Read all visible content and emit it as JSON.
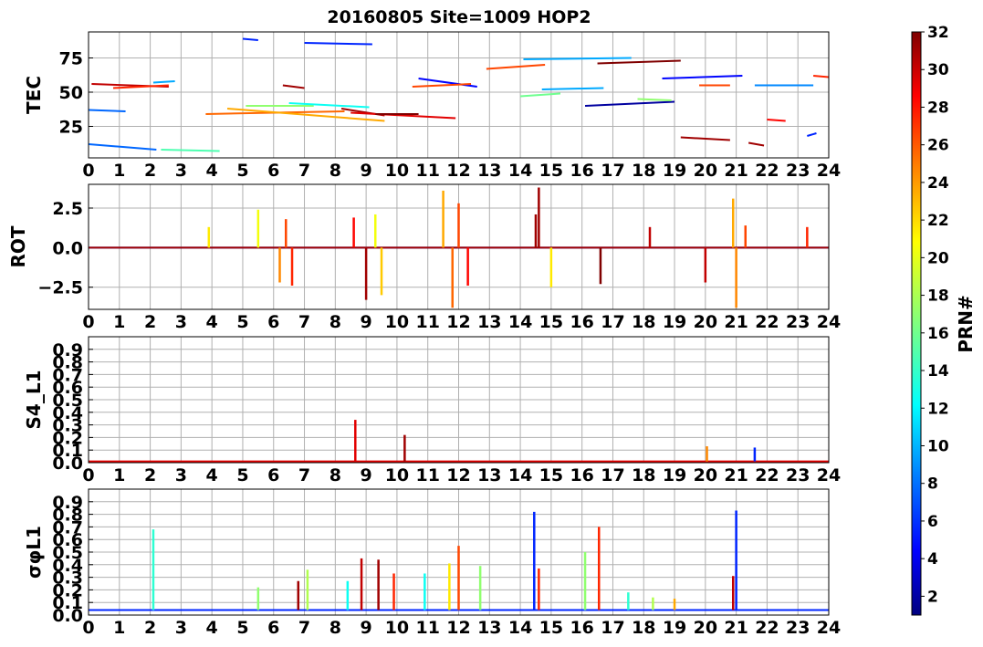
{
  "chart_data": {
    "title": "20160805 Site=1009 HOP2",
    "type": "line",
    "x_ticks": [
      "0",
      "1",
      "2",
      "3",
      "4",
      "5",
      "6",
      "7",
      "8",
      "9",
      "10",
      "11",
      "12",
      "13",
      "14",
      "15",
      "16",
      "17",
      "18",
      "19",
      "20",
      "21",
      "22",
      "23",
      "24"
    ],
    "xlim": [
      0,
      24
    ],
    "grid": true,
    "colorbar": {
      "label": "PRN#",
      "range": [
        1,
        32
      ],
      "ticks": [
        "2",
        "4",
        "6",
        "8",
        "10",
        "12",
        "14",
        "16",
        "18",
        "20",
        "22",
        "24",
        "26",
        "28",
        "30",
        "32"
      ],
      "colormap": [
        "#00007f",
        "#0000ff",
        "#007fff",
        "#00ffff",
        "#7fff7f",
        "#ffff00",
        "#ff7f00",
        "#ff0000",
        "#7f0000"
      ]
    },
    "panels": [
      {
        "ylabel": "TEC",
        "ylim": [
          2,
          94
        ],
        "y_ticks": [
          "25",
          "50",
          "75"
        ],
        "series": [
          {
            "prn": 8,
            "x": [
              0,
              1.2
            ],
            "y": [
              37,
              36
            ]
          },
          {
            "prn": 8,
            "x": [
              0,
              2.2
            ],
            "y": [
              12,
              8
            ]
          },
          {
            "prn": 15,
            "x": [
              2.35,
              4.25
            ],
            "y": [
              8,
              7
            ]
          },
          {
            "prn": 30,
            "x": [
              0.1,
              2.6
            ],
            "y": [
              56,
              54
            ]
          },
          {
            "prn": 27,
            "x": [
              0.8,
              2.6
            ],
            "y": [
              53,
              55
            ]
          },
          {
            "prn": 10,
            "x": [
              2.1,
              2.8
            ],
            "y": [
              57,
              58
            ]
          },
          {
            "prn": 25,
            "x": [
              3.8,
              8.3
            ],
            "y": [
              34,
              36
            ]
          },
          {
            "prn": 23,
            "x": [
              4.5,
              9.6
            ],
            "y": [
              38,
              29
            ]
          },
          {
            "prn": 17,
            "x": [
              5.1,
              7.3
            ],
            "y": [
              40,
              40
            ]
          },
          {
            "prn": 13,
            "x": [
              6.5,
              9.1
            ],
            "y": [
              42,
              39
            ]
          },
          {
            "prn": 31,
            "x": [
              8.2,
              9.6
            ],
            "y": [
              38,
              33
            ]
          },
          {
            "prn": 29,
            "x": [
              8.5,
              11.9
            ],
            "y": [
              35,
              31
            ]
          },
          {
            "prn": 32,
            "x": [
              9.3,
              10.7
            ],
            "y": [
              34,
              34
            ]
          },
          {
            "prn": 31,
            "x": [
              6.3,
              7.0
            ],
            "y": [
              55,
              53
            ]
          },
          {
            "prn": 6,
            "x": [
              5.0,
              5.5
            ],
            "y": [
              89,
              88
            ]
          },
          {
            "prn": 6,
            "x": [
              7.0,
              9.2
            ],
            "y": [
              86,
              85
            ]
          },
          {
            "prn": 5,
            "x": [
              10.7,
              12.6
            ],
            "y": [
              60,
              54
            ]
          },
          {
            "prn": 26,
            "x": [
              10.5,
              12.4
            ],
            "y": [
              54,
              56
            ]
          },
          {
            "prn": 26,
            "x": [
              12.9,
              14.8
            ],
            "y": [
              67,
              70
            ]
          },
          {
            "prn": 10,
            "x": [
              14.1,
              17.6
            ],
            "y": [
              74,
              75
            ]
          },
          {
            "prn": 16,
            "x": [
              14.0,
              15.3
            ],
            "y": [
              47,
              49
            ]
          },
          {
            "prn": 10,
            "x": [
              14.7,
              16.7
            ],
            "y": [
              52,
              53
            ]
          },
          {
            "prn": 32,
            "x": [
              16.5,
              19.2
            ],
            "y": [
              71,
              73
            ]
          },
          {
            "prn": 2,
            "x": [
              16.1,
              19.0
            ],
            "y": [
              40,
              43
            ]
          },
          {
            "prn": 17,
            "x": [
              17.8,
              18.9
            ],
            "y": [
              45,
              44
            ]
          },
          {
            "prn": 5,
            "x": [
              18.6,
              21.2
            ],
            "y": [
              60,
              62
            ]
          },
          {
            "prn": 31,
            "x": [
              19.2,
              20.8
            ],
            "y": [
              17,
              15
            ]
          },
          {
            "prn": 31,
            "x": [
              21.4,
              21.9
            ],
            "y": [
              13,
              11
            ]
          },
          {
            "prn": 9,
            "x": [
              21.6,
              23.5
            ],
            "y": [
              55,
              55
            ]
          },
          {
            "prn": 28,
            "x": [
              22.0,
              22.6
            ],
            "y": [
              30,
              29
            ]
          },
          {
            "prn": 26,
            "x": [
              19.8,
              20.8
            ],
            "y": [
              55,
              55
            ]
          },
          {
            "prn": 27,
            "x": [
              23.5,
              24.0
            ],
            "y": [
              62,
              61
            ]
          },
          {
            "prn": 6,
            "x": [
              23.3,
              23.6
            ],
            "y": [
              18,
              20
            ]
          }
        ]
      },
      {
        "ylabel": "ROT",
        "ylim": [
          -3.9,
          4.0
        ],
        "y_ticks": [
          "−2.5",
          "0.0",
          "2.5"
        ],
        "series": [
          {
            "prn": 6,
            "x": [
              0,
              24
            ],
            "y": [
              0,
              0
            ]
          },
          {
            "prn": 31,
            "x": [
              0,
              24
            ],
            "y": [
              0,
              0
            ]
          }
        ],
        "spikes": [
          {
            "x": 3.9,
            "y": 1.3
          },
          {
            "x": 5.5,
            "y": 2.4
          },
          {
            "x": 6.2,
            "y": -2.2
          },
          {
            "x": 6.4,
            "y": 1.8
          },
          {
            "x": 6.6,
            "y": -2.4
          },
          {
            "x": 8.6,
            "y": 1.9
          },
          {
            "x": 9.0,
            "y": -3.3
          },
          {
            "x": 9.3,
            "y": 2.1
          },
          {
            "x": 9.5,
            "y": -3.0
          },
          {
            "x": 11.5,
            "y": 3.6
          },
          {
            "x": 11.8,
            "y": -3.8
          },
          {
            "x": 12.0,
            "y": 2.8
          },
          {
            "x": 12.3,
            "y": -2.4
          },
          {
            "x": 14.5,
            "y": 2.1
          },
          {
            "x": 14.6,
            "y": 3.8
          },
          {
            "x": 15.0,
            "y": -2.5
          },
          {
            "x": 16.6,
            "y": -2.3
          },
          {
            "x": 18.2,
            "y": 1.3
          },
          {
            "x": 20.0,
            "y": -2.2
          },
          {
            "x": 20.9,
            "y": 3.1
          },
          {
            "x": 21.0,
            "y": -3.8
          },
          {
            "x": 21.3,
            "y": 1.4
          },
          {
            "x": 23.3,
            "y": 1.3
          }
        ]
      },
      {
        "ylabel": "S4_L1",
        "ylim": [
          0,
          1.0
        ],
        "y_ticks": [
          "0.0",
          "0.1",
          "0.2",
          "0.3",
          "0.4",
          "0.5",
          "0.6",
          "0.7",
          "0.8",
          "0.9"
        ],
        "series": [
          {
            "prn": 29,
            "x": [
              0,
              24
            ],
            "y": [
              0.01,
              0.01
            ]
          }
        ],
        "spikes": [
          {
            "prn": 29,
            "x": 8.65,
            "y": 0.34
          },
          {
            "prn": 31,
            "x": 10.25,
            "y": 0.22
          },
          {
            "prn": 24,
            "x": 20.05,
            "y": 0.13
          },
          {
            "prn": 6,
            "x": 21.6,
            "y": 0.12
          }
        ]
      },
      {
        "ylabel": "σφL1",
        "ylim": [
          0,
          1.0
        ],
        "y_ticks": [
          "0.0",
          "0.1",
          "0.2",
          "0.3",
          "0.4",
          "0.5",
          "0.6",
          "0.7",
          "0.8",
          "0.9"
        ],
        "series": [
          {
            "prn": 6,
            "x": [
              0,
              24
            ],
            "y": [
              0.04,
              0.04
            ]
          }
        ],
        "spikes": [
          {
            "prn": 14,
            "x": 2.1,
            "y": 0.68
          },
          {
            "prn": 17,
            "x": 5.5,
            "y": 0.22
          },
          {
            "prn": 31,
            "x": 6.8,
            "y": 0.27
          },
          {
            "prn": 18,
            "x": 7.1,
            "y": 0.36
          },
          {
            "prn": 13,
            "x": 8.4,
            "y": 0.27
          },
          {
            "prn": 30,
            "x": 8.85,
            "y": 0.45
          },
          {
            "prn": 31,
            "x": 9.4,
            "y": 0.44
          },
          {
            "prn": 27,
            "x": 9.9,
            "y": 0.33
          },
          {
            "prn": 13,
            "x": 10.9,
            "y": 0.33
          },
          {
            "prn": 21,
            "x": 11.7,
            "y": 0.41
          },
          {
            "prn": 26,
            "x": 12.0,
            "y": 0.55
          },
          {
            "prn": 17,
            "x": 12.7,
            "y": 0.39
          },
          {
            "prn": 6,
            "x": 14.45,
            "y": 0.82
          },
          {
            "prn": 27,
            "x": 14.6,
            "y": 0.37
          },
          {
            "prn": 17,
            "x": 16.1,
            "y": 0.5
          },
          {
            "prn": 27,
            "x": 16.55,
            "y": 0.7
          },
          {
            "prn": 14,
            "x": 17.5,
            "y": 0.18
          },
          {
            "prn": 18,
            "x": 18.3,
            "y": 0.14
          },
          {
            "prn": 6,
            "x": 21.0,
            "y": 0.83
          },
          {
            "prn": 30,
            "x": 20.9,
            "y": 0.31
          },
          {
            "prn": 23,
            "x": 19.0,
            "y": 0.13
          }
        ]
      }
    ]
  }
}
